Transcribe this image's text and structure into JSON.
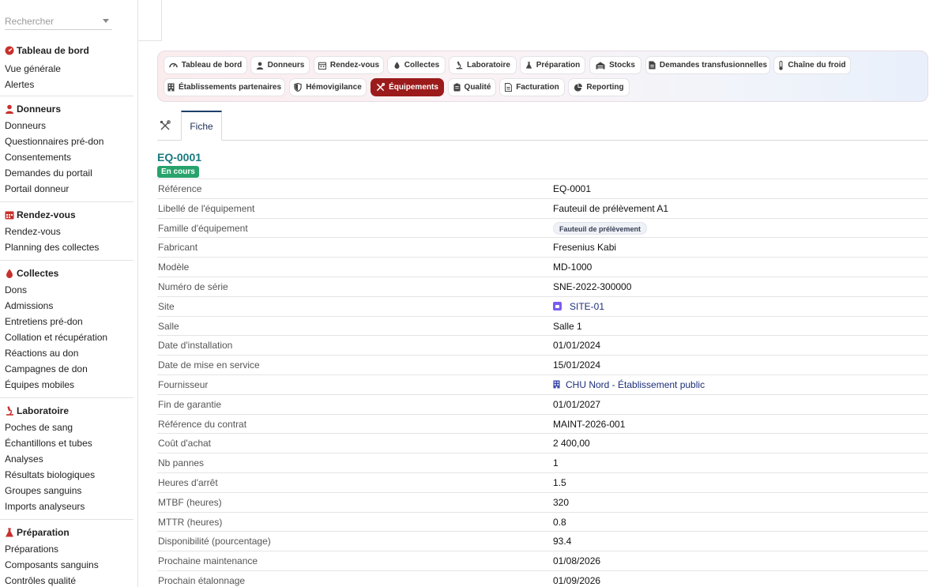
{
  "search": {
    "placeholder": "Rechercher"
  },
  "sidebar": {
    "sections": [
      {
        "title": "Tableau de bord",
        "icon": "dashboard-gauge-icon",
        "items": [
          "Vue générale",
          "Alertes"
        ]
      },
      {
        "title": "Donneurs",
        "icon": "user-icon",
        "items": [
          "Donneurs",
          "Questionnaires pré-don",
          "Consentements",
          "Demandes du portail",
          "Portail donneur"
        ]
      },
      {
        "title": "Rendez-vous",
        "icon": "calendar-icon",
        "items": [
          "Rendez-vous",
          "Planning des collectes"
        ]
      },
      {
        "title": "Collectes",
        "icon": "blood-drop-icon",
        "items": [
          "Dons",
          "Admissions",
          "Entretiens pré-don",
          "Collation et récupération",
          "Réactions au don",
          "Campagnes de don",
          "Équipes mobiles"
        ]
      },
      {
        "title": "Laboratoire",
        "icon": "microscope-icon",
        "items": [
          "Poches de sang",
          "Échantillons et tubes",
          "Analyses",
          "Résultats biologiques",
          "Groupes sanguins",
          "Imports analyseurs"
        ]
      },
      {
        "title": "Préparation",
        "icon": "flask-icon",
        "items": [
          "Préparations",
          "Composants sanguins",
          "Contrôles qualité"
        ]
      }
    ]
  },
  "modules": [
    {
      "label": "Tableau de bord",
      "icon": "gauge-icon",
      "active": false
    },
    {
      "label": "Donneurs",
      "icon": "user-icon",
      "active": false
    },
    {
      "label": "Rendez-vous",
      "icon": "calendar-icon",
      "active": false
    },
    {
      "label": "Collectes",
      "icon": "blood-drop-icon",
      "active": false
    },
    {
      "label": "Laboratoire",
      "icon": "microscope-icon",
      "active": false
    },
    {
      "label": "Préparation",
      "icon": "flask-icon",
      "active": false
    },
    {
      "label": "Stocks",
      "icon": "warehouse-icon",
      "active": false
    },
    {
      "label": "Demandes transfusionnelles",
      "icon": "document-icon",
      "active": false
    },
    {
      "label": "Chaîne du froid",
      "icon": "thermometer-icon",
      "active": false
    },
    {
      "label": "Établissements partenaires",
      "icon": "building-icon",
      "active": false
    },
    {
      "label": "Hémovigilance",
      "icon": "shield-icon",
      "active": false
    },
    {
      "label": "Équipements",
      "icon": "tools-icon",
      "active": true
    },
    {
      "label": "Qualité",
      "icon": "clipboard-icon",
      "active": false
    },
    {
      "label": "Facturation",
      "icon": "invoice-icon",
      "active": false
    },
    {
      "label": "Reporting",
      "icon": "pie-chart-icon",
      "active": false
    }
  ],
  "tabs": {
    "fiche": "Fiche"
  },
  "record": {
    "title": "EQ-0001",
    "status": "En cours",
    "fields": [
      {
        "label": "Référence",
        "value": "EQ-0001",
        "kind": "text"
      },
      {
        "label": "Libellé de l'équipement",
        "value": "Fauteuil de prélèvement A1",
        "kind": "text"
      },
      {
        "label": "Famille d'équipement",
        "value": "Fauteuil de prélèvement",
        "kind": "pill"
      },
      {
        "label": "Fabricant",
        "value": "Fresenius Kabi",
        "kind": "text"
      },
      {
        "label": "Modèle",
        "value": "MD-1000",
        "kind": "text"
      },
      {
        "label": "Numéro de série",
        "value": "SNE-2022-300000",
        "kind": "text"
      },
      {
        "label": "Site",
        "value": "SITE-01",
        "kind": "site-link"
      },
      {
        "label": "Salle",
        "value": "Salle 1",
        "kind": "text"
      },
      {
        "label": "Date d'installation",
        "value": "01/01/2024",
        "kind": "text"
      },
      {
        "label": "Date de mise en service",
        "value": "15/01/2024",
        "kind": "text"
      },
      {
        "label": "Fournisseur",
        "value": "CHU Nord - Établissement public",
        "kind": "building-link"
      },
      {
        "label": "Fin de garantie",
        "value": "01/01/2027",
        "kind": "text"
      },
      {
        "label": "Référence du contrat",
        "value": "MAINT-2026-001",
        "kind": "text"
      },
      {
        "label": "Coût d'achat",
        "value": "2 400,00",
        "kind": "money"
      },
      {
        "label": "Nb pannes",
        "value": "1",
        "kind": "text"
      },
      {
        "label": "Heures d'arrêt",
        "value": "1.5",
        "kind": "text"
      },
      {
        "label": "MTBF (heures)",
        "value": "320",
        "kind": "text"
      },
      {
        "label": "MTTR (heures)",
        "value": "0.8",
        "kind": "text"
      },
      {
        "label": "Disponibilité (pourcentage)",
        "value": "93.4",
        "kind": "text"
      },
      {
        "label": "Prochaine maintenance",
        "value": "01/08/2026",
        "kind": "text"
      },
      {
        "label": "Prochain étalonnage",
        "value": "01/09/2026",
        "kind": "text"
      }
    ]
  },
  "colors": {
    "accent": "#9b1b1b",
    "teal": "#187a80",
    "status_green": "#27a36b",
    "link_navy": "#1c2f7a"
  }
}
